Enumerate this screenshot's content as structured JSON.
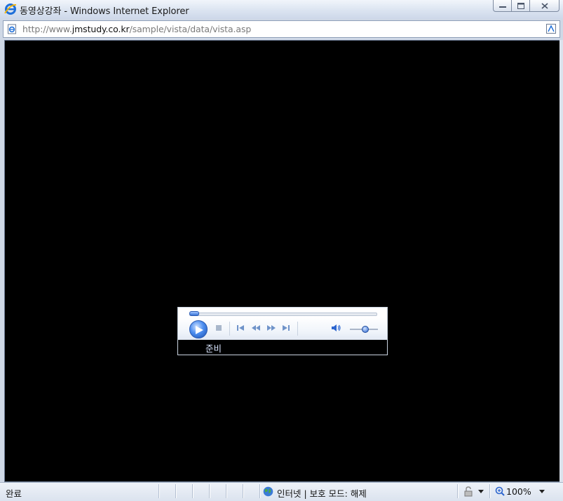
{
  "window": {
    "title": "동영상강좌 - Windows Internet Explorer"
  },
  "address_bar": {
    "url_prefix": "http://www.",
    "url_domain": "jmstudy.co.kr",
    "url_path": "/sample/vista/data/vista.asp"
  },
  "player": {
    "status": "준비",
    "progress": 0,
    "volume": 0.55,
    "icons": [
      "play-icon",
      "stop-icon",
      "previous-icon",
      "rewind-icon",
      "fast-forward-icon",
      "next-icon",
      "speaker-icon"
    ]
  },
  "status_bar": {
    "left_text": "완료",
    "zone_text": "인터넷 | 보호 모드: 해제",
    "zoom_text": "100%"
  },
  "colors": {
    "content_bg": "#000000",
    "player_accent": "#2d66cf",
    "chrome": "#dbe3ef"
  }
}
